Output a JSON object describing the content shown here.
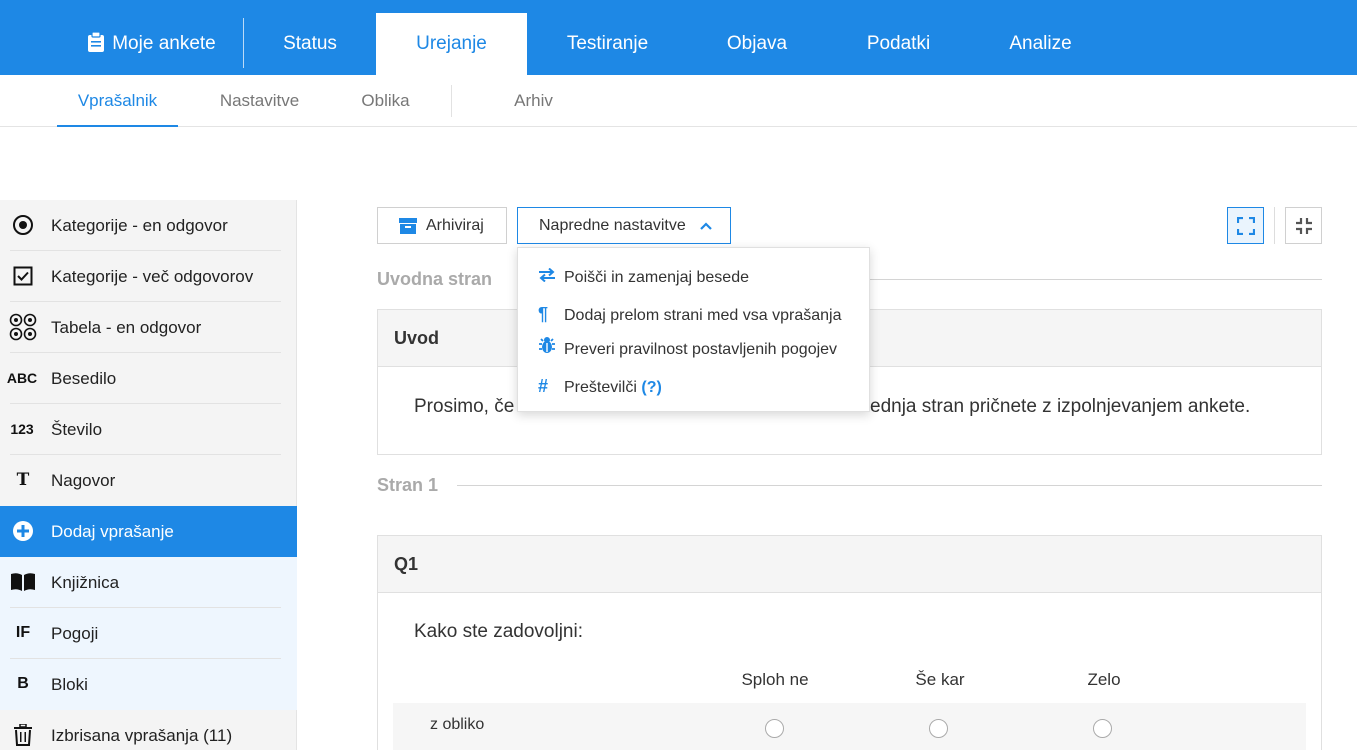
{
  "topnav": {
    "my_surveys": "Moje ankete",
    "tabs": [
      "Status",
      "Urejanje",
      "Testiranje",
      "Objava",
      "Podatki",
      "Analize"
    ],
    "active_tab": "Urejanje"
  },
  "subnav": {
    "tabs": [
      "Vprašalnik",
      "Nastavitve",
      "Oblika",
      "Arhiv"
    ],
    "active_tab": "Vprašalnik"
  },
  "sidebar": {
    "items": [
      {
        "icon": "radio-dot-icon",
        "label": "Kategorije - en odgovor"
      },
      {
        "icon": "checkbox-icon",
        "label": "Kategorije - več odgovorov"
      },
      {
        "icon": "table-radio-icon",
        "label": "Tabela - en odgovor"
      },
      {
        "icon": "text-icon",
        "glyph": "ABC",
        "label": "Besedilo"
      },
      {
        "icon": "number-icon",
        "glyph": "123",
        "label": "Število"
      },
      {
        "icon": "text-t-icon",
        "glyph": "T",
        "label": "Nagovor"
      },
      {
        "icon": "plus-circle-icon",
        "label": "Dodaj vprašanje"
      },
      {
        "icon": "book-icon",
        "label": "Knjižnica"
      },
      {
        "icon": "if-icon",
        "glyph": "IF",
        "label": "Pogoji"
      },
      {
        "icon": "block-icon",
        "glyph": "B",
        "label": "Bloki"
      },
      {
        "icon": "trash-icon",
        "label": "Izbrisana vprašanja (11)"
      }
    ]
  },
  "toolbar": {
    "archive_label": "Arhiviraj",
    "advanced_label": "Napredne nastavitve"
  },
  "dropdown": {
    "items": [
      {
        "icon": "swap-icon",
        "label": "Poišči in zamenjaj besede"
      },
      {
        "icon": "pilcrow-icon",
        "label": "Dodaj prelom strani med vsa vprašanja"
      },
      {
        "icon": "bug-icon",
        "label": "Preveri pravilnost postavljenih pogojev"
      },
      {
        "icon": "hash-icon",
        "label": "Preštevilči",
        "help": "(?)"
      }
    ]
  },
  "sections": {
    "intro_page": "Uvodna stran",
    "page1": "Stran 1"
  },
  "intro": {
    "title": "Uvod",
    "text_left": "Prosimo, če",
    "text_right": "ednja stran pričnete z izpolnjevanjem ankete."
  },
  "q1": {
    "id": "Q1",
    "text": "Kako ste zadovoljni:",
    "columns": [
      "Sploh ne",
      "Še kar",
      "Zelo"
    ],
    "rows": [
      "z obliko"
    ]
  },
  "colors": {
    "primary": "#1e88e5",
    "sidebar_bg": "#f4f4f4",
    "sidebar_light": "#eef6fe"
  }
}
